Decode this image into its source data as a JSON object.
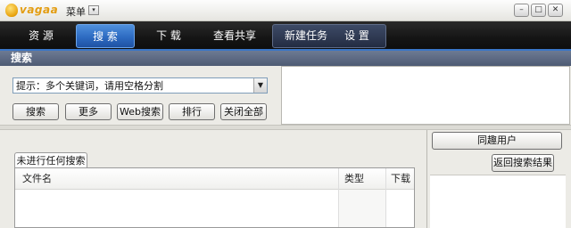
{
  "app": {
    "logo_text": "vagaa",
    "menu_label": "菜单"
  },
  "tabs": [
    {
      "label": "资 源"
    },
    {
      "label": "搜 索"
    },
    {
      "label": "下 载"
    },
    {
      "label": "查看共享"
    },
    {
      "label": "新建任务"
    },
    {
      "label": "设 置"
    }
  ],
  "section": {
    "title": "搜索"
  },
  "search": {
    "dropdown_value": "提示：多个关键词，请用空格分割",
    "buttons": {
      "search": "搜索",
      "more": "更多",
      "web_search": "Web搜索",
      "rank": "排行",
      "close_all": "关闭全部"
    }
  },
  "results": {
    "tab_label": "未进行任何搜索",
    "columns": [
      "文件名",
      "类型",
      "下载"
    ]
  },
  "side": {
    "same_interest_users": "同趣用户",
    "back_to_results": "返回搜索结果"
  },
  "colors": {
    "tab_active": "#2d6bc2",
    "tab_bar": "#141414",
    "section_header": "#5a667e",
    "logo": "#e39d12"
  }
}
